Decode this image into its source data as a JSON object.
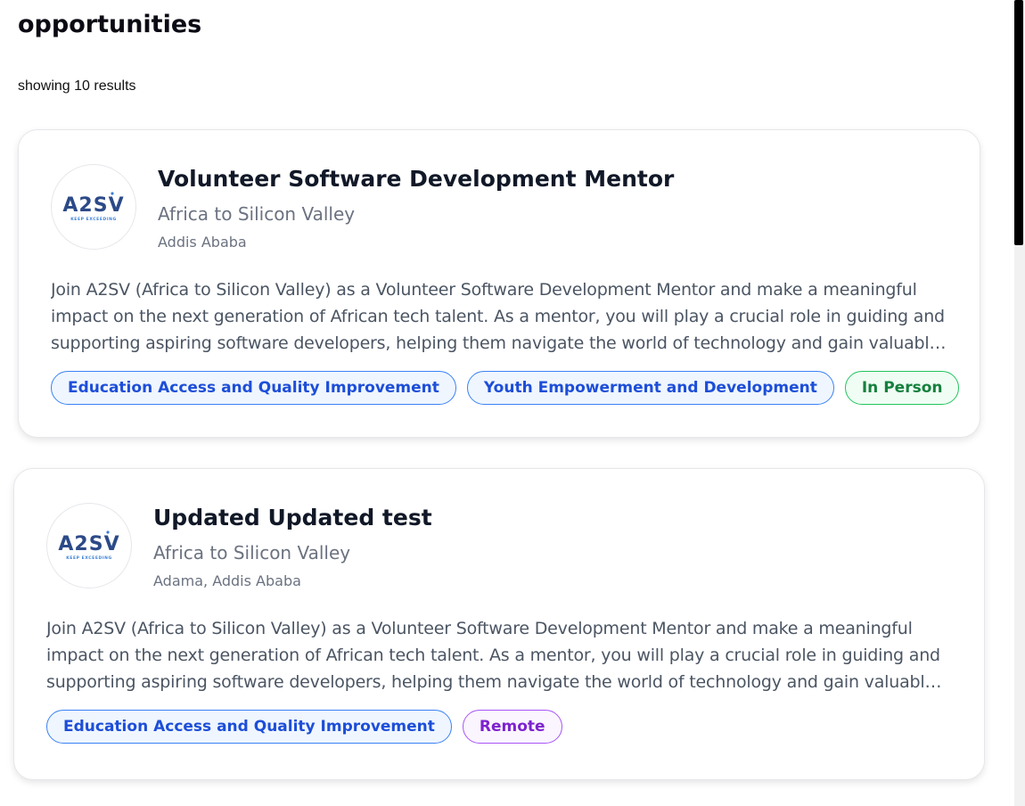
{
  "page": {
    "title": "opportunities",
    "result_count": "showing 10 results"
  },
  "colors": {
    "accent_blue": "#1d4ed8",
    "accent_green": "#15803d",
    "accent_purple": "#7e22ce",
    "logo_blue": "#2c4a88"
  },
  "cards": [
    {
      "logo_icon": "a2sv-logo",
      "logo_text": "A2SV",
      "logo_tagline": "KEEP EXCEEDING",
      "title": "Volunteer Software Development Mentor",
      "organization": "Africa to Silicon Valley",
      "location": "Addis Ababa",
      "description": "Join A2SV (Africa to Silicon Valley) as a Volunteer Software Development Mentor and make a meaningful impact on the next generation of African tech talent. As a mentor, you will play a crucial role in guiding and supporting aspiring software developers, helping them navigate the world of technology and gain valuable insights and skills.",
      "tags": [
        {
          "label": "Education Access and Quality Improvement"
        },
        {
          "label": "Youth Empowerment and Development"
        },
        {
          "label": "In Person"
        }
      ]
    },
    {
      "logo_icon": "a2sv-logo",
      "logo_text": "A2SV",
      "logo_tagline": "KEEP EXCEEDING",
      "title": "Updated Updated test",
      "organization": "Africa to Silicon Valley",
      "location": "Adama, Addis Ababa",
      "description": "Join A2SV (Africa to Silicon Valley) as a Volunteer Software Development Mentor and make a meaningful impact on the next generation of African tech talent. As a mentor, you will play a crucial role in guiding and supporting aspiring software developers, helping them navigate the world of technology and gain valuable insights and skills.",
      "tags": [
        {
          "label": "Education Access and Quality Improvement"
        },
        {
          "label": "Remote"
        }
      ]
    }
  ]
}
